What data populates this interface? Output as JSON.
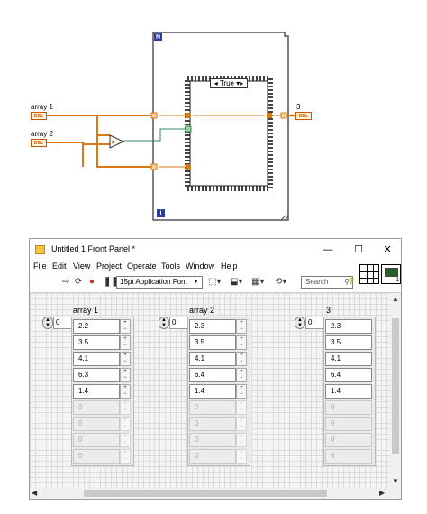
{
  "diagram": {
    "array1_label": "array 1",
    "array2_label": "array 2",
    "output_label": "3",
    "dbl_tag": "DBL",
    "case_selector": "True",
    "loop_count_terminal": "N",
    "loop_iteration_terminal": "i"
  },
  "window": {
    "title": "Untitled 1 Front Panel *",
    "minimize": "—",
    "maximize": "☐",
    "close": "✕"
  },
  "menus": [
    "File",
    "Edit",
    "View",
    "Project",
    "Operate",
    "Tools",
    "Window",
    "Help"
  ],
  "toolbar": {
    "font": "15pt Application Font",
    "search_placeholder": "Search",
    "help": "?",
    "vi_icon_number": "1"
  },
  "arrays": [
    {
      "label": "array 1",
      "index": "0",
      "values": [
        "2.2",
        "3.5",
        "4.1",
        "6.3",
        "1.4"
      ],
      "empty_values": [
        "0",
        "0",
        "0",
        "0"
      ]
    },
    {
      "label": "array 2",
      "index": "0",
      "values": [
        "2.3",
        "3.5",
        "4.1",
        "6.4",
        "1.4"
      ],
      "empty_values": [
        "0",
        "0",
        "0",
        "0"
      ]
    },
    {
      "label": "3",
      "index": "0",
      "values": [
        "2.3",
        "3.5",
        "4.1",
        "6.4",
        "1.4"
      ],
      "empty_values": [
        "0",
        "0",
        "0",
        "0"
      ]
    }
  ],
  "colors": {
    "wire_orange": "#d97b14",
    "wire_green": "#2e8b57",
    "case_border": "#555555",
    "loop_border": "#555555"
  }
}
